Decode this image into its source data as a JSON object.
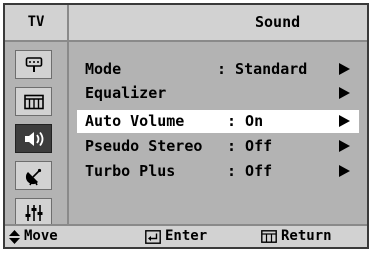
{
  "header": {
    "source_label": "TV",
    "title": "Sound"
  },
  "sidebar": {
    "tabs": [
      {
        "icon": "input-connector-icon",
        "active": false
      },
      {
        "icon": "picture-icon",
        "active": false
      },
      {
        "icon": "speaker-icon",
        "active": true
      },
      {
        "icon": "satellite-dish-icon",
        "active": false
      },
      {
        "icon": "setup-sliders-icon",
        "active": false
      }
    ]
  },
  "menu": {
    "items": [
      {
        "label": "Mode",
        "value": ": Standard",
        "selected": false
      },
      {
        "label": "Equalizer",
        "value": "",
        "selected": false
      },
      {
        "label": "Auto Volume",
        "value": ": On",
        "selected": true
      },
      {
        "label": "Pseudo Stereo",
        "value": ": Off",
        "selected": false
      },
      {
        "label": "Turbo Plus",
        "value": ": Off",
        "selected": false
      }
    ]
  },
  "footer": {
    "move_label": "Move",
    "enter_label": "Enter",
    "return_label": "Return"
  },
  "colors": {
    "panel": "#b3b3b3",
    "bar": "#d2d2d2",
    "highlight": "#ffffff",
    "active_tab": "#3d3d3d"
  }
}
